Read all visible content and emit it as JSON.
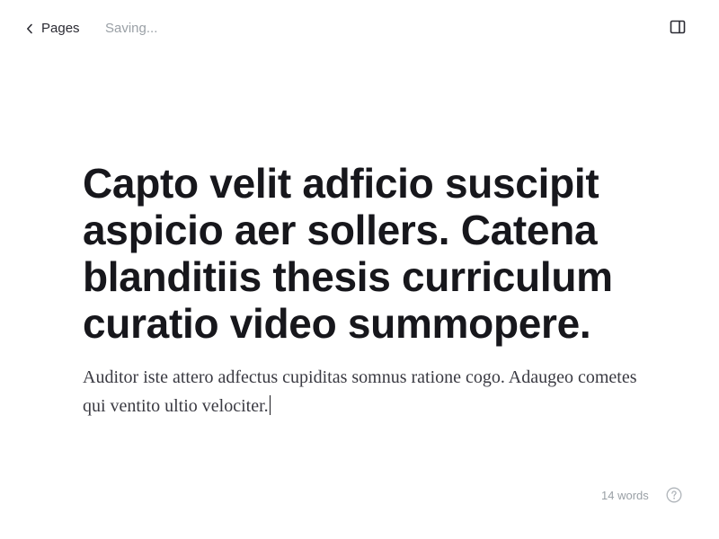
{
  "header": {
    "back_label": "Pages",
    "back_icon": "chevron-left-icon",
    "status_text": "Saving...",
    "panel_toggle_icon": "sidebar-panel-icon"
  },
  "document": {
    "title": "Capto velit adficio suscipit aspicio aer sollers. Catena blanditiis thesis curriculum curatio video summopere.",
    "body": "Auditor iste attero adfectus cupiditas somnus ratione cogo. Adaugeo cometes qui ventito ultio velociter."
  },
  "footer": {
    "word_count": "14 words",
    "help_icon": "help-circle-icon"
  },
  "colors": {
    "text_primary": "#17171c",
    "text_body": "#3a3a42",
    "text_muted": "#9aa0a6",
    "background": "#ffffff"
  }
}
